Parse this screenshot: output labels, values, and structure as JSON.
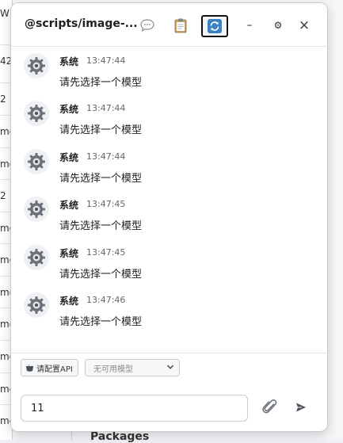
{
  "background": {
    "cells": [
      "W",
      "42",
      "2",
      "mc",
      "mc",
      "2",
      "mc",
      "mc",
      "mc",
      "mc",
      "mc",
      "mc",
      "mc"
    ],
    "bottom_text": "Packages"
  },
  "window": {
    "title": "@scripts/image-...",
    "toolbar": {
      "chat_icon": "speech-bubble-icon",
      "clipboard_icon": "clipboard-icon",
      "refresh_icon": "refresh-icon"
    },
    "controls": {
      "minimize": "–",
      "settings": "⚙",
      "close": "×"
    }
  },
  "messages": [
    {
      "sender": "系统",
      "time": "13:47:44",
      "text": "请先选择一个模型"
    },
    {
      "sender": "系统",
      "time": "13:47:44",
      "text": "请先选择一个模型"
    },
    {
      "sender": "系统",
      "time": "13:47:44",
      "text": "请先选择一个模型"
    },
    {
      "sender": "系统",
      "time": "13:47:45",
      "text": "请先选择一个模型"
    },
    {
      "sender": "系统",
      "time": "13:47:45",
      "text": "请先选择一个模型"
    },
    {
      "sender": "系统",
      "time": "13:47:46",
      "text": "请先选择一个模型"
    }
  ],
  "footer": {
    "api_button_label": "请配置API",
    "model_select_value": "无可用模型",
    "input_value": "11"
  }
}
